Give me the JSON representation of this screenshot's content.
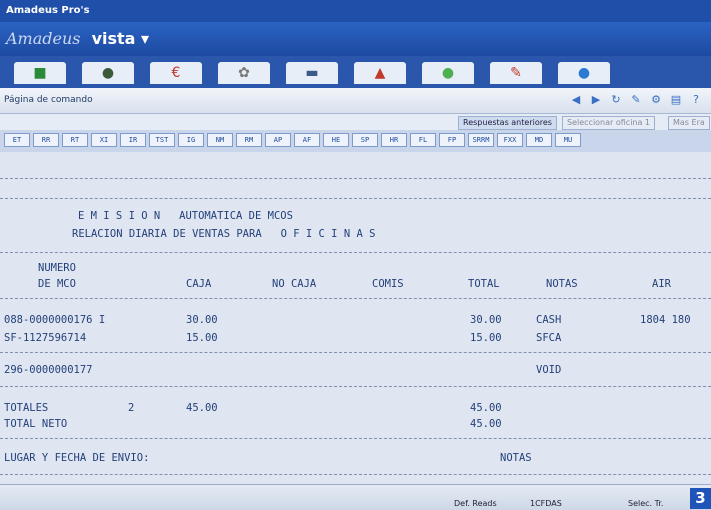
{
  "window": {
    "title": "Amadeus Pro's"
  },
  "app": {
    "brand_prefix": "Amadeus",
    "brand_name": "vista ▾"
  },
  "tabs": [
    {
      "icon": "book-icon"
    },
    {
      "icon": "globe-icon"
    },
    {
      "icon": "euro-icon"
    },
    {
      "icon": "flower-icon"
    },
    {
      "icon": "car-icon"
    },
    {
      "icon": "person-icon"
    },
    {
      "icon": "green-circle-icon"
    },
    {
      "icon": "document-icon"
    },
    {
      "icon": "blue-globe-icon"
    }
  ],
  "toolbar": {
    "label": "Página de comando"
  },
  "subtabs": {
    "active": "Respuestas anteriores",
    "other": "Seleccionar oficina 1",
    "third": "Mas Era"
  },
  "keys": [
    "ET",
    "RR",
    "RT",
    "XI",
    "IR",
    "TST",
    "IG",
    "NM",
    "RM",
    "AP",
    "AF",
    "HE",
    "SP",
    "HR",
    "FL",
    "FP",
    "SRRM",
    "FXX",
    "MD",
    "MU"
  ],
  "report": {
    "title_line": "E M I S I O N   AUTOMATICA DE MCOS",
    "subtitle_line": "RELACION DIARIA DE VENTAS PARA   O F I C I N A S",
    "col_header_1a": "NUMERO",
    "col_header_1b": "DE MCO",
    "col_headers": [
      "CAJA",
      "NO CAJA",
      "COMIS",
      "TOTAL",
      "NOTAS",
      "AIR"
    ],
    "rows": [
      {
        "numero": "088-0000000176 I",
        "caja": "30.00",
        "total": "30.00",
        "notas": "CASH",
        "air": "1804 180"
      },
      {
        "numero": "SF-1127596714",
        "caja": "15.00",
        "total": "15.00",
        "notas": "SFCA",
        "air": ""
      },
      {
        "numero": "296-0000000177",
        "caja": "",
        "total": "",
        "notas": "VOID",
        "air": ""
      }
    ],
    "totales_label": "TOTALES",
    "totales_count": "2",
    "totales_caja": "45.00",
    "totales_total": "45.00",
    "total_neto_label": "TOTAL NETO",
    "total_neto_value": "45.00",
    "lugar_label": "LUGAR Y FECHA DE ENVIO:",
    "notas_label": "NOTAS"
  },
  "status": {
    "a": "Def. Reads",
    "b": "1CFDAS",
    "c": "Selec. Tr."
  },
  "page_badge": "3"
}
